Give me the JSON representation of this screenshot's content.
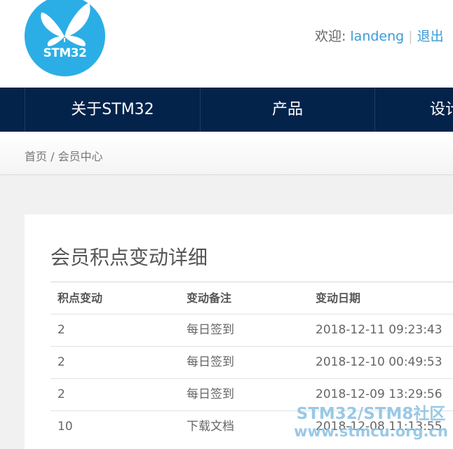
{
  "logo": {
    "text": "STM32"
  },
  "header": {
    "welcome_label": "欢迎:",
    "username": "landeng",
    "separator": "|",
    "logout_label": "退出"
  },
  "nav": {
    "items": [
      {
        "label": "关于STM32"
      },
      {
        "label": "产品"
      },
      {
        "label": "设计"
      }
    ]
  },
  "breadcrumb": {
    "text": "首页 / 会员中心"
  },
  "main": {
    "title": "会员积点变动详细",
    "table": {
      "headers": [
        "积点变动",
        "变动备注",
        "变动日期"
      ],
      "rows": [
        [
          "2",
          "每日签到",
          "2018-12-11 09:23:43"
        ],
        [
          "2",
          "每日签到",
          "2018-12-10 00:49:53"
        ],
        [
          "2",
          "每日签到",
          "2018-12-09 13:29:56"
        ],
        [
          "10",
          "下载文档",
          "2018-12-08 11:13:55"
        ]
      ]
    }
  },
  "watermark": {
    "line1": "STM32/STM8社区",
    "line2": "www.stmcu.org.cn"
  }
}
